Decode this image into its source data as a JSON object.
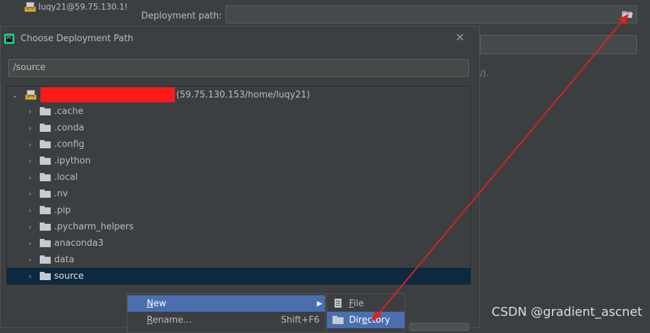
{
  "background": {
    "server_label": "luqy21@59.75.130.1!",
    "deployment_path_label": "Deployment path:",
    "deployment_path_value": "",
    "partial_note": "/)."
  },
  "dialog": {
    "title": "Choose Deployment Path",
    "path_value": "/source",
    "tree": {
      "root_suffix": "(59.75.130.153/home/luqy21)",
      "items": [
        {
          "label": ".cache"
        },
        {
          "label": ".conda"
        },
        {
          "label": ".config"
        },
        {
          "label": ".ipython"
        },
        {
          "label": ".local"
        },
        {
          "label": ".nv"
        },
        {
          "label": ".pip"
        },
        {
          "label": ".pycharm_helpers"
        },
        {
          "label": "anaconda3"
        },
        {
          "label": "data"
        },
        {
          "label": "source"
        }
      ],
      "selected": "source"
    }
  },
  "context_menu": {
    "items": [
      {
        "label_pre": "",
        "label_ul": "N",
        "label_post": "ew",
        "shortcut": "",
        "has_submenu": true
      },
      {
        "label_pre": "",
        "label_ul": "R",
        "label_post": "ename...",
        "shortcut": "Shift+F6",
        "has_submenu": false
      }
    ]
  },
  "submenu": {
    "items": [
      {
        "icon": "file-icon",
        "label_pre": "",
        "label_ul": "F",
        "label_post": "ile"
      },
      {
        "icon": "directory-icon",
        "label_pre": "Dir",
        "label_ul": "e",
        "label_post": "ctory"
      }
    ]
  },
  "watermark": "CSDN @gradient_ascnet",
  "colors": {
    "accent_selection": "#4b6eaf",
    "tree_selected_row": "#0d293e",
    "annotation_arrow": "#e0201e",
    "redaction": "#ff1a1a"
  }
}
